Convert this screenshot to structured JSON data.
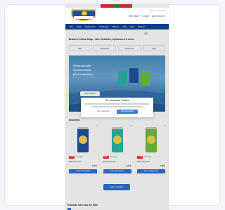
{
  "header": {
    "top_links": "Service · Kontakt",
    "icons_label": "Merkliste · Login · Warenkorb",
    "nav_items": [
      "Bier",
      "Wein",
      "Spirituosen",
      "Softdrinks",
      "Wasser",
      "Saft",
      "Sale",
      "Marken"
    ]
  },
  "page": {
    "heading": "Brauerei Online-Shop – Bier, Getränke, Spirituosen & mehr",
    "categories": [
      "Bier",
      "Softdrinks",
      "Spirituosen",
      "Sale"
    ]
  },
  "hero": {
    "line1": "Erfrischender",
    "line2": "Sommerdrink",
    "line3": "jetzt entdecken",
    "cta": "Jetzt kaufen"
  },
  "modal": {
    "title": "Wir verwenden Cookies",
    "decline": "Nur notwendige",
    "accept": "Alle akzeptieren",
    "link": "Einstellungen"
  },
  "products": {
    "section_title": "Neuheiten",
    "items": [
      {
        "name": "Dosenbier 0,33l",
        "price": "1,29 €",
        "badge": "-10%",
        "stock": "Auf Lager",
        "add": "In den Warenkorb",
        "color": "#1b4f9b"
      },
      {
        "name": "Radler Dose 0,5l",
        "price": "1,49 €",
        "badge": "-10%",
        "stock": "Auf Lager",
        "add": "In den Warenkorb",
        "color": "#2bb3a4"
      },
      {
        "name": "Zitronenbier 0,5l",
        "price": "1,59 €",
        "badge": "-10%",
        "stock": "Auf Lager",
        "add": "In den Warenkorb",
        "color": "#6bbf3a"
      }
    ],
    "more_button": "Alle Produkte"
  },
  "footer": {
    "bottom_title": "Entdecke mehr aus der Welt"
  },
  "colors": {
    "brand": "#0f3d87",
    "accent": "#2f6fd0",
    "sale": "#e03a3a"
  }
}
